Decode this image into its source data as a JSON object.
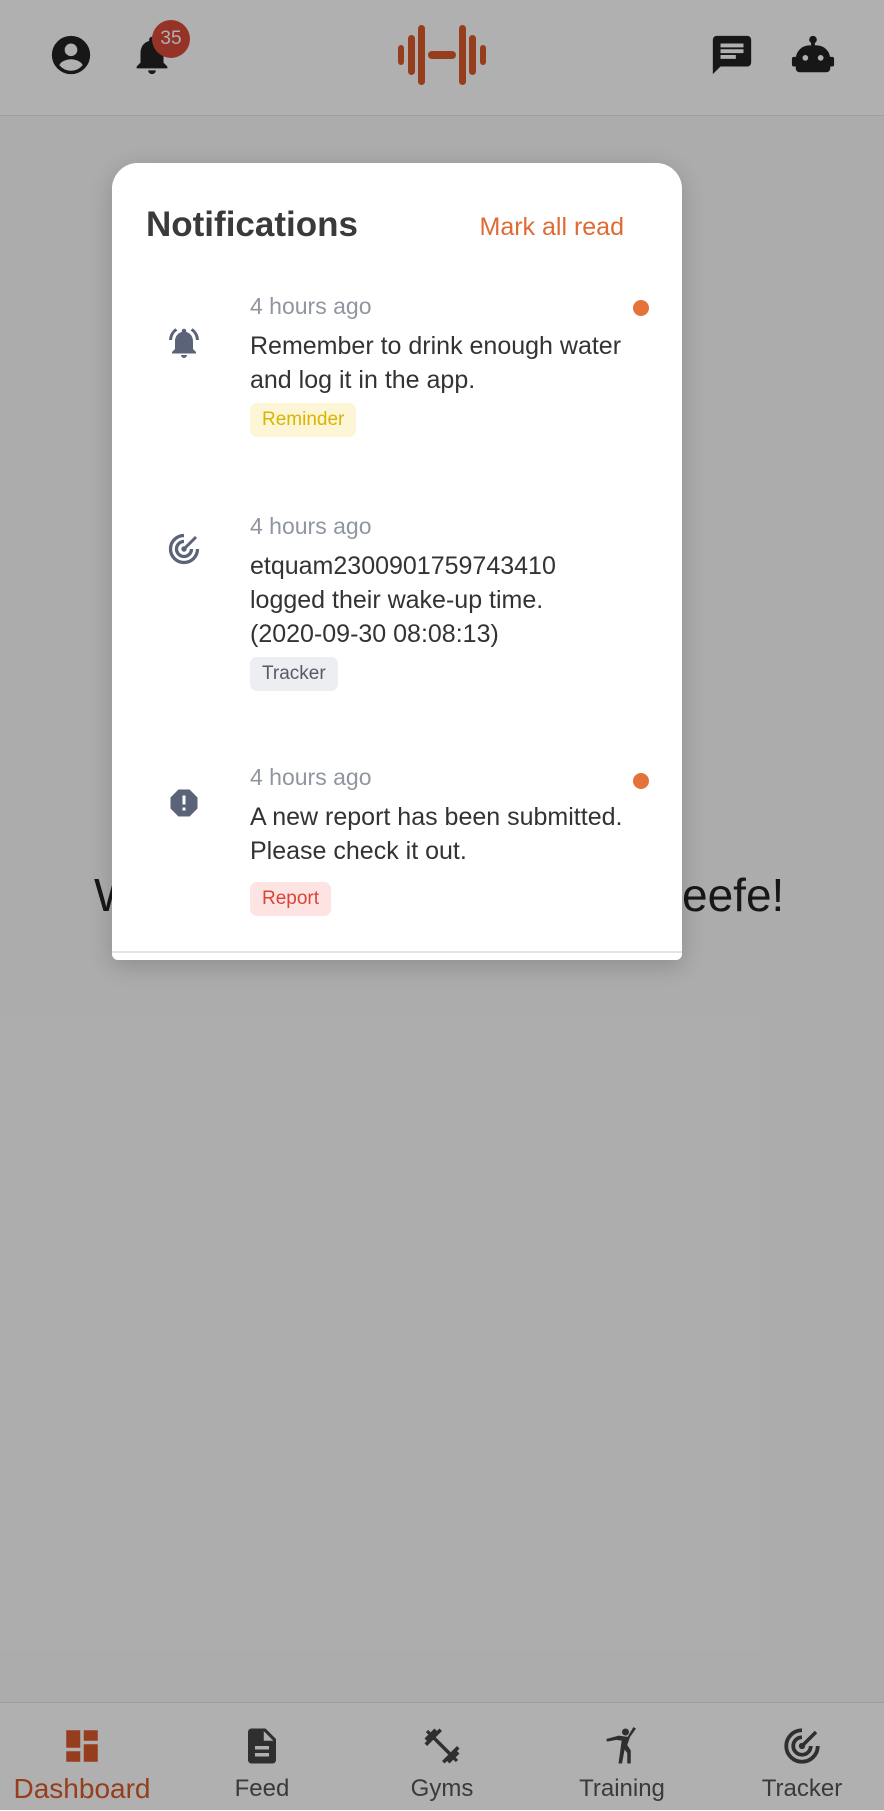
{
  "header": {
    "notification_count": "35",
    "icons": [
      "account-circle-icon",
      "bell-icon",
      "dumbbell-logo-icon",
      "chat-icon",
      "robot-icon"
    ]
  },
  "welcome": {
    "text_left": "W",
    "text_right": "eefe!"
  },
  "notifications_panel": {
    "title": "Notifications",
    "mark_all_read": "Mark all read",
    "items": [
      {
        "time": "4 hours ago",
        "message": "Remember to drink enough water and log it in the app.",
        "tag": "Reminder",
        "tag_color": "#d9b400",
        "tag_bg": "#fdf6d6",
        "icon": "bell-ring-icon",
        "unread": true
      },
      {
        "time": "4 hours ago",
        "message": "etquam2300901759743410 logged their wake-up time. (2020-09-30 08:08:13)",
        "tag": "Tracker",
        "tag_color": "#555b66",
        "tag_bg": "#eceef1",
        "icon": "tracker-icon",
        "unread": false
      },
      {
        "time": "4 hours ago",
        "message": "A new report has been submitted. Please check it out.",
        "tag": "Report",
        "tag_color": "#d9443a",
        "tag_bg": "#fde4e2",
        "icon": "report-alert-icon",
        "unread": true
      }
    ]
  },
  "bottom_nav": {
    "items": [
      {
        "label": "Dashboard",
        "icon": "dashboard-icon",
        "active": true
      },
      {
        "label": "Feed",
        "icon": "feed-icon",
        "active": false
      },
      {
        "label": "Gyms",
        "icon": "gyms-icon",
        "active": false
      },
      {
        "label": "Training",
        "icon": "training-icon",
        "active": false
      },
      {
        "label": "Tracker",
        "icon": "tracker-icon",
        "active": false
      }
    ]
  },
  "colors": {
    "accent": "#d9592a",
    "unread_dot": "#e4723b",
    "badge": "#d84a3a",
    "icon_dark": "#222222",
    "icon_slate": "#5b6378"
  }
}
